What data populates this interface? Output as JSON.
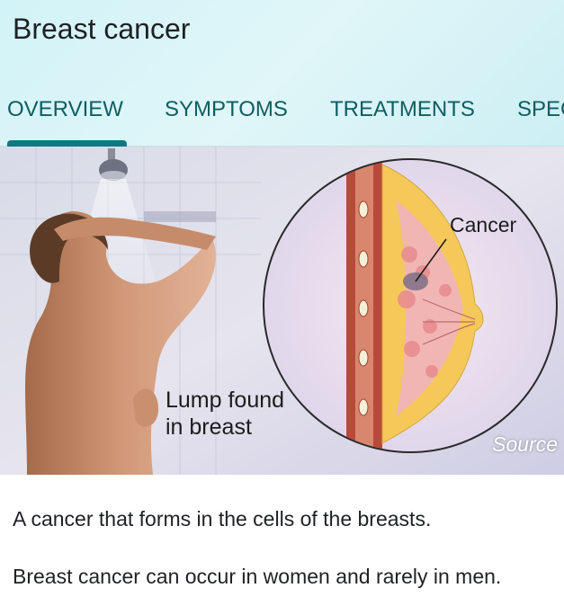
{
  "header": {
    "title": "Breast cancer"
  },
  "tabs": [
    {
      "label": "OVERVIEW",
      "selected": true
    },
    {
      "label": "SYMPTOMS",
      "selected": false
    },
    {
      "label": "TREATMENTS",
      "selected": false
    },
    {
      "label": "SPECIALISTS",
      "selected": false
    }
  ],
  "image": {
    "label_lump_line1": "Lump found",
    "label_lump_line2": "in breast",
    "label_cancer": "Cancer",
    "source_link": "Source"
  },
  "description": {
    "line1": "A cancer that forms in the cells of the breasts.",
    "line2": "Breast cancer can occur in women and rarely in men."
  },
  "colors": {
    "header_bg": "#d6f3f6",
    "tab_text": "#0f5d62",
    "tab_indicator": "#0b7a82"
  }
}
